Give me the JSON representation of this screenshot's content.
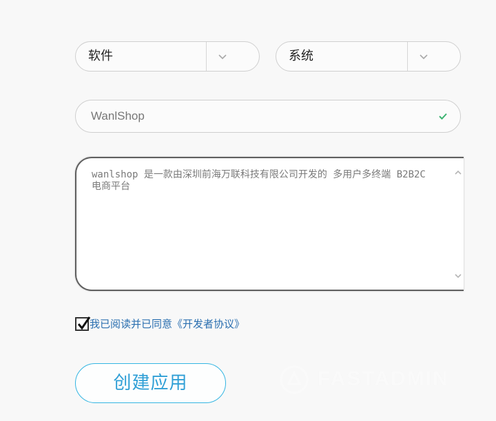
{
  "form": {
    "category_select": {
      "value": "软件",
      "icon": "chevron-down-icon"
    },
    "type_select": {
      "value": "系统",
      "icon": "chevron-down-icon"
    },
    "app_name": {
      "value": "WanlShop",
      "valid_icon": "check-icon",
      "valid_color": "#3cb371"
    },
    "description": {
      "value": "wanlshop 是一款由深圳前海万联科技有限公司开发的 多用户多终端 B2B2C电商平台"
    },
    "agreement": {
      "checked": true,
      "label": "我已阅读并已同意《开发者协议》"
    },
    "create_button": {
      "label": "创建应用"
    }
  },
  "watermark": {
    "text": "FASTADMIN",
    "icon": "fastadmin-logo"
  },
  "colors": {
    "accent": "#2f9fd6",
    "link": "#2a6fb0",
    "valid": "#3cb371"
  }
}
